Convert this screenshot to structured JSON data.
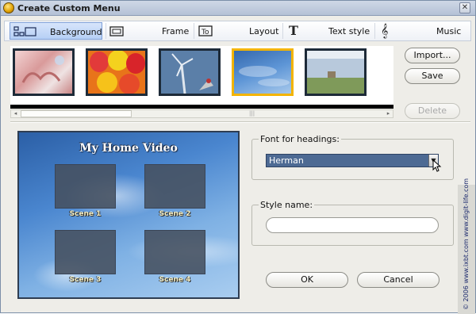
{
  "window": {
    "title": "Create Custom Menu",
    "close_label": "✕"
  },
  "tabs": [
    {
      "label": "Background",
      "icon": "background-icon",
      "active": true
    },
    {
      "label": "Frame",
      "icon": "frame-icon",
      "active": false
    },
    {
      "label": "Layout",
      "icon": "layout-icon",
      "active": false
    },
    {
      "label": "Text style",
      "icon": "text-style-icon",
      "active": false
    },
    {
      "label": "Music",
      "icon": "music-icon",
      "active": false
    }
  ],
  "thumbnails": [
    {
      "name": "pink-bow",
      "selected": false
    },
    {
      "name": "balloons",
      "selected": false
    },
    {
      "name": "windmill",
      "selected": false
    },
    {
      "name": "blue-sky",
      "selected": true
    },
    {
      "name": "field",
      "selected": false
    }
  ],
  "buttons": {
    "import": "Import...",
    "save": "Save",
    "delete": "Delete",
    "ok": "OK",
    "cancel": "Cancel"
  },
  "preview": {
    "title": "My Home Video",
    "scenes": [
      "Scene 1",
      "Scene 2",
      "Scene 3",
      "Scene 4"
    ]
  },
  "font_group": {
    "legend": "Font for headings:",
    "selected_font": "Herman"
  },
  "style_group": {
    "legend": "Style name:",
    "value": ""
  },
  "copyright": "© 2006 www.ixbt.com  www.digit-life.com",
  "colors": {
    "selection_accent": "#f3b400",
    "active_tab": "#b6cff5",
    "font_select": "#4d6a93"
  }
}
